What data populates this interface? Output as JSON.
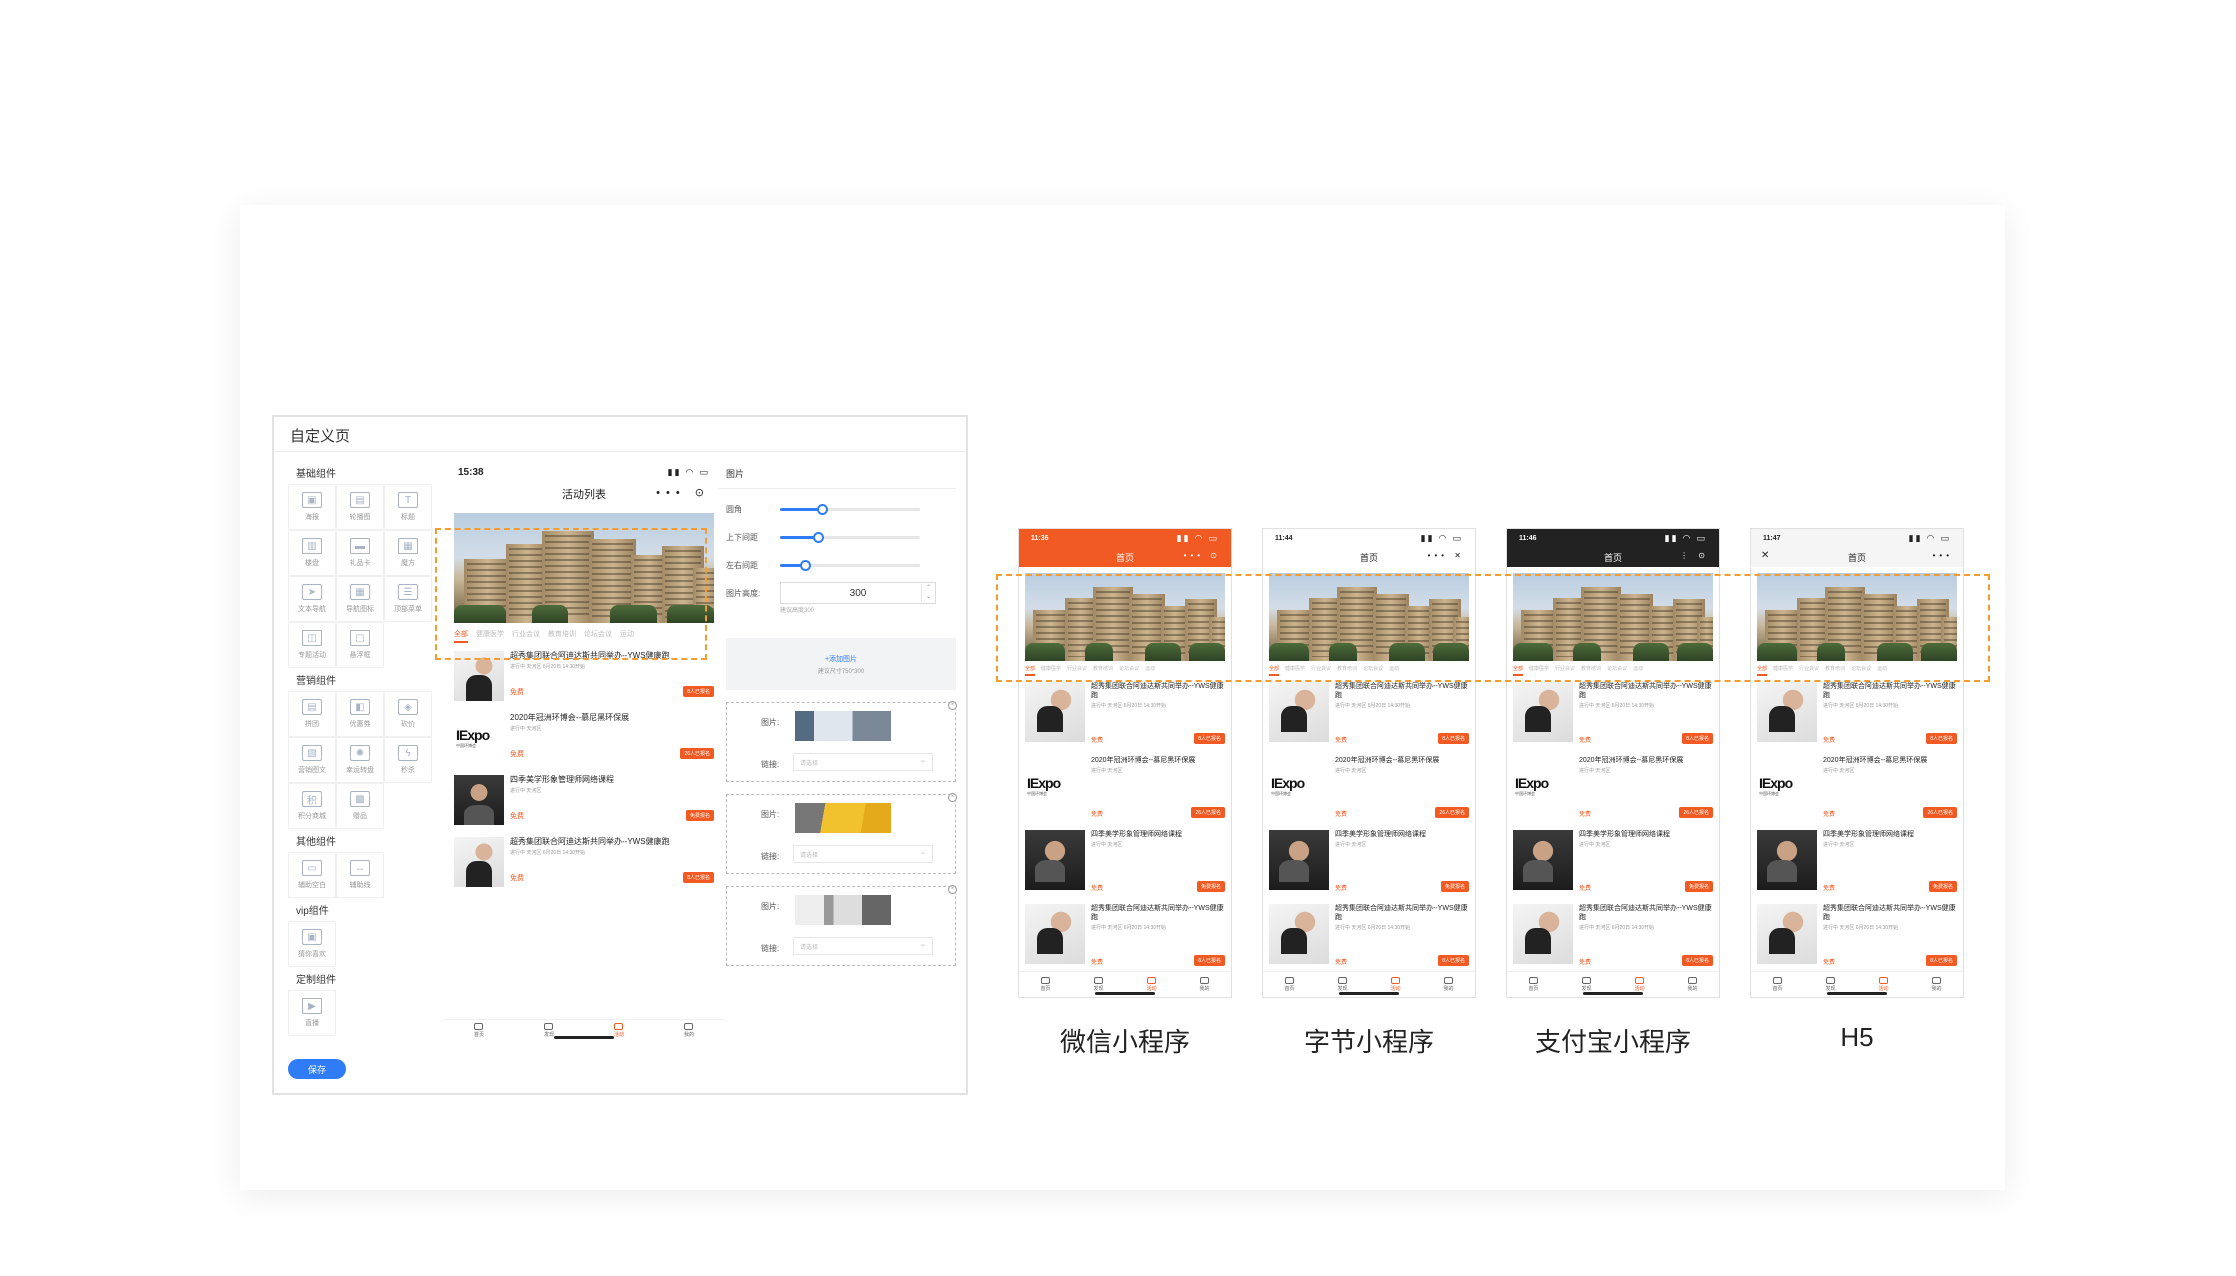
{
  "editor": {
    "title": "自定义页",
    "save_label": "保存",
    "groups": [
      {
        "title": "基础组件",
        "items": [
          {
            "label": "海报",
            "icon": "image-icon"
          },
          {
            "label": "轮播图",
            "icon": "carousel-icon"
          },
          {
            "label": "标题",
            "icon": "title-icon"
          },
          {
            "label": "楼盘",
            "icon": "building-icon"
          },
          {
            "label": "礼品卡",
            "icon": "gift-card-icon"
          },
          {
            "label": "魔方",
            "icon": "grid-icon"
          },
          {
            "label": "文本导航",
            "icon": "navigation-icon"
          },
          {
            "label": "导航图标",
            "icon": "nav-grid-icon"
          },
          {
            "label": "顶部菜单",
            "icon": "top-menu-icon"
          },
          {
            "label": "专题活动",
            "icon": "topic-icon"
          },
          {
            "label": "悬浮框",
            "icon": "float-icon"
          }
        ]
      },
      {
        "title": "营销组件",
        "items": [
          {
            "label": "拼团",
            "icon": "group-buy-icon"
          },
          {
            "label": "优惠券",
            "icon": "coupon-icon"
          },
          {
            "label": "砍价",
            "icon": "tag-icon"
          },
          {
            "label": "营销图文",
            "icon": "article-icon"
          },
          {
            "label": "幸运转盘",
            "icon": "wheel-icon"
          },
          {
            "label": "秒杀",
            "icon": "flash-icon"
          },
          {
            "label": "积分商城",
            "icon": "points-icon"
          },
          {
            "label": "赠品",
            "icon": "present-icon"
          }
        ]
      },
      {
        "title": "其他组件",
        "items": [
          {
            "label": "辅助空白",
            "icon": "blank-icon"
          },
          {
            "label": "辅助线",
            "icon": "line-icon"
          }
        ]
      },
      {
        "title": "vip组件",
        "items": [
          {
            "label": "猜你喜欢",
            "icon": "like-icon"
          }
        ]
      },
      {
        "title": "定制组件",
        "items": [
          {
            "label": "直播",
            "icon": "live-icon"
          }
        ]
      }
    ],
    "phone": {
      "time": "15:38",
      "nav_title": "活动列表",
      "nav_actions": "•••  ⊙",
      "tabs": [
        "全部",
        "健康医学",
        "行业会议",
        "教育培训",
        "论坛会议",
        "运动"
      ]
    },
    "settings": {
      "header": "图片",
      "sliders": [
        {
          "label": "圆角",
          "value": 0.3
        },
        {
          "label": "上下间距",
          "value": 0.27
        },
        {
          "label": "左右间距",
          "value": 0.18
        }
      ],
      "height_label": "图片高度:",
      "height_value": "300",
      "height_hint": "建议高度300",
      "add_label": "+添加图片",
      "add_hint": "建议尺寸750*300",
      "image_label": "图片:",
      "link_label": "链接:",
      "link_placeholder": "请选择"
    }
  },
  "events": [
    {
      "title": "超秀集团联合阿迪达斯共同举办--YWS健康跑",
      "meta": "进行中   天河区   6月20日   14:30开始",
      "price": "免费",
      "badge": "8人已报名",
      "thumb": "woman"
    },
    {
      "title": "2020年冠洲环博会--慕尼黑环保展",
      "meta": "进行中   天河区",
      "price": "免费",
      "badge": "26人已报名",
      "thumb": "expo"
    },
    {
      "title": "四季美学形象管理师网络课程",
      "meta": "进行中   天河区",
      "price": "免费",
      "badge": "免费报名",
      "thumb": "man"
    },
    {
      "title": "超秀集团联合阿迪达斯共同举办--YWS健康跑",
      "meta": "进行中   天河区   6月20日   14:30开始",
      "price": "免费",
      "badge": "8人已报名",
      "thumb": "woman"
    }
  ],
  "expo_logo": {
    "main": "IExpo",
    "sub": "中国环博会"
  },
  "tabbar": [
    {
      "label": "首页",
      "icon": "home-icon"
    },
    {
      "label": "发现",
      "icon": "discover-icon"
    },
    {
      "label": "活动",
      "icon": "flag-icon"
    },
    {
      "label": "我的",
      "icon": "user-icon"
    }
  ],
  "platforms": [
    {
      "label": "微信小程序",
      "time": "11:36",
      "nav_title": "首页",
      "nav_bg": "#f15a22",
      "nav_color": "#ffffff",
      "actions": "••• ⊙",
      "left": ""
    },
    {
      "label": "字节小程序",
      "time": "11:44",
      "nav_title": "首页",
      "nav_bg": "#ffffff",
      "nav_color": "#222222",
      "actions": "••• ✕",
      "left": ""
    },
    {
      "label": "支付宝小程序",
      "time": "11:46",
      "nav_title": "首页",
      "nav_bg": "#222222",
      "nav_color": "#ffffff",
      "actions": "⋮ ⊙",
      "left": ""
    },
    {
      "label": "H5",
      "time": "11:47",
      "nav_title": "首页",
      "nav_bg": "#f5f5f5",
      "nav_color": "#222222",
      "actions": "•••",
      "left": "✕"
    }
  ],
  "colors": {
    "accent": "#f15a22",
    "primary": "#2f7cf6",
    "highlight": "#f39c32"
  }
}
